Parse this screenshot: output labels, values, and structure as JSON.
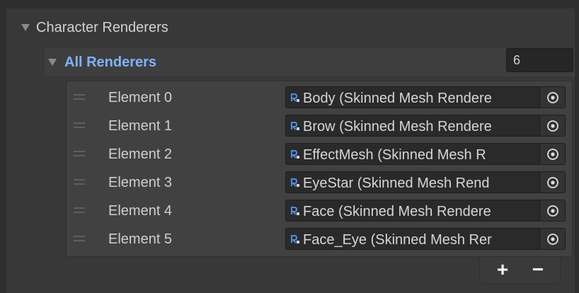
{
  "section": {
    "title": "Character Renderers"
  },
  "list": {
    "title": "All Renderers",
    "size": "6",
    "elements": [
      {
        "label": "Element 0",
        "value": "Body (Skinned Mesh Rendere"
      },
      {
        "label": "Element 1",
        "value": "Brow (Skinned Mesh Rendere"
      },
      {
        "label": "Element 2",
        "value": "EffectMesh (Skinned Mesh R"
      },
      {
        "label": "Element 3",
        "value": "EyeStar (Skinned Mesh Rend"
      },
      {
        "label": "Element 4",
        "value": "Face (Skinned Mesh Rendere"
      },
      {
        "label": "Element 5",
        "value": "Face_Eye (Skinned Mesh Rer"
      }
    ],
    "add_label": "+",
    "remove_label": "−"
  },
  "colors": {
    "accent_title": "#7fb3ff",
    "mesh_icon": "#4a90e2"
  },
  "icons": {
    "foldout": "triangle-down-icon",
    "drag": "drag-handle-icon",
    "mesh": "skinned-mesh-renderer-icon",
    "picker": "object-picker-icon"
  }
}
